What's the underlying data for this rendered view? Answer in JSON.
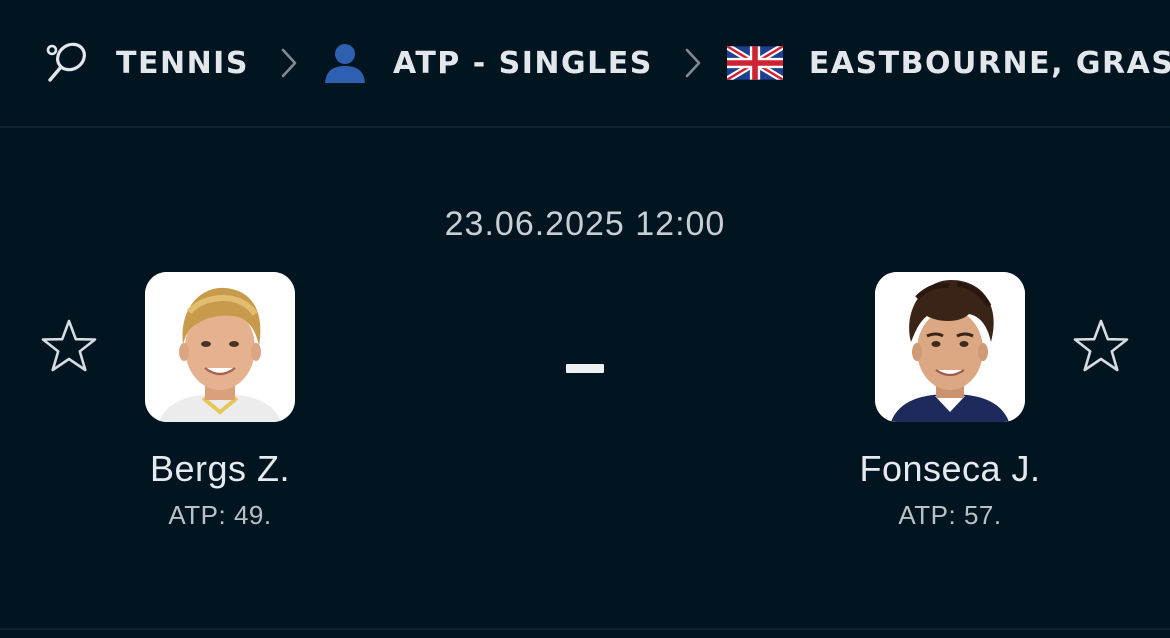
{
  "breadcrumb": {
    "items": [
      {
        "label": "TENNIS",
        "icon": "tennis-racket-icon"
      },
      {
        "label": "ATP - SINGLES",
        "icon": "person-icon"
      },
      {
        "label": "EASTBOURNE, GRAS",
        "icon": "uk-flag-icon"
      }
    ],
    "separator_icon": "chevron-right-icon"
  },
  "match": {
    "datetime": "23.06.2025 12:00",
    "score": "-",
    "home": {
      "name": "Bergs Z.",
      "rank": "ATP: 49.",
      "favorite_icon": "star-outline-icon"
    },
    "away": {
      "name": "Fonseca J.",
      "rank": "ATP: 57.",
      "favorite_icon": "star-outline-icon"
    }
  },
  "colors": {
    "background": "#011521",
    "text": "#e3e7ec",
    "muted_text": "#b9c0c7",
    "person_icon": "#2f5fb0",
    "divider": "#0b2433"
  }
}
